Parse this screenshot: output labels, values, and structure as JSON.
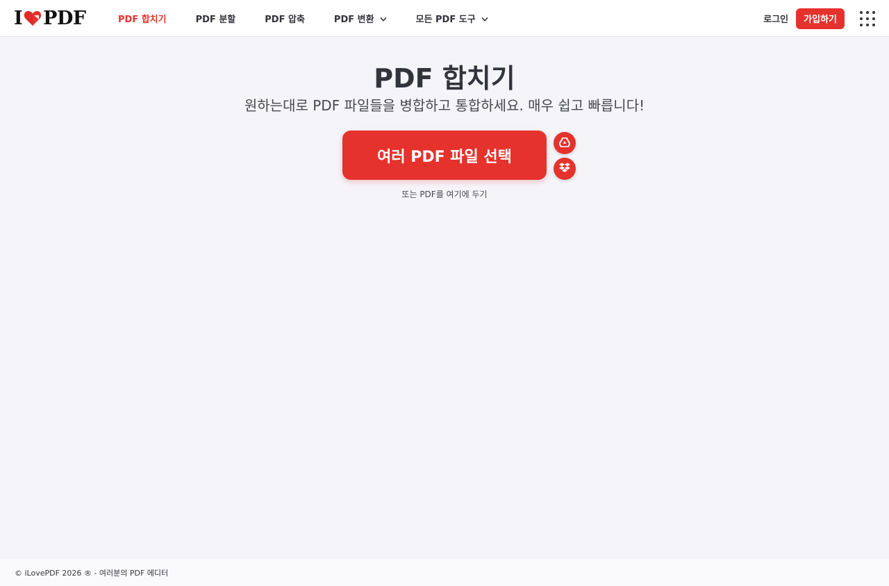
{
  "header": {
    "logo": {
      "left": "I",
      "right": "PDF"
    },
    "nav": [
      {
        "label": "PDF 합치기",
        "active": true
      },
      {
        "label": "PDF 분할"
      },
      {
        "label": "PDF 압축"
      },
      {
        "label": "PDF 변환",
        "dropdown": true
      },
      {
        "label": "모든 PDF 도구",
        "dropdown": true
      }
    ],
    "login_label": "로그인",
    "signup_label": "가입하기",
    "apps_icon": "grid-icon"
  },
  "main": {
    "title": "PDF 합치기",
    "subtitle": "원하는대로 PDF 파일들을 병합하고 통합하세요. 매우 쉽고 빠릅니다!",
    "select_button_label": "여러 PDF 파일 선택",
    "cloud_buttons": [
      "google-drive-icon",
      "dropbox-icon"
    ],
    "drop_hint": "또는 PDF를 여기에 두기"
  },
  "footer": {
    "text": "© iLovePDF 2026 ® - 여러분의 PDF 에디터"
  },
  "colors": {
    "accent": "#e5322d",
    "background": "#f4f4f9",
    "text": "#33333b"
  }
}
